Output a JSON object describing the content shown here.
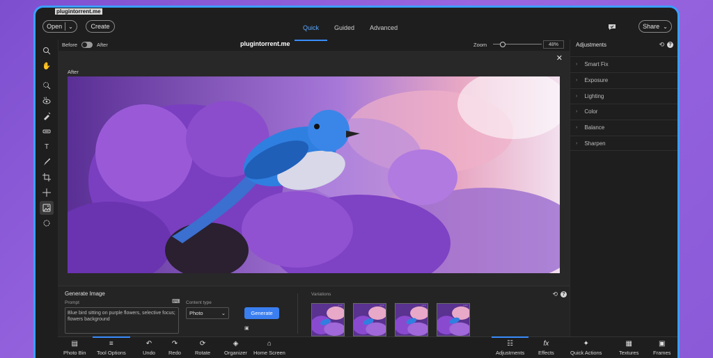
{
  "watermark_top": "plugintorrent.me",
  "watermark_mid": "plugintorrent.me",
  "topbar": {
    "open_label": "Open",
    "create_label": "Create",
    "share_label": "Share",
    "modes": [
      "Quick",
      "Guided",
      "Advanced"
    ],
    "active_mode": "Quick"
  },
  "canvas_head": {
    "before_label": "Before",
    "after_label": "After",
    "zoom_label": "Zoom",
    "zoom_value": "48%",
    "zoom_fraction": 0.15
  },
  "canvas": {
    "view_label": "After",
    "close_glyph": "✕"
  },
  "right_panel": {
    "title": "Adjustments",
    "items": [
      "Smart Fix",
      "Exposure",
      "Lighting",
      "Color",
      "Balance",
      "Sharpen"
    ]
  },
  "generate": {
    "title": "Generate Image",
    "prompt_label": "Prompt",
    "prompt_text": "Blue bird sitting on purple flowers, selective focus; flowers background",
    "content_type_label": "Content type",
    "content_type_value": "Photo",
    "generate_label": "Generate",
    "variations_label": "Variations",
    "variation_count": 4
  },
  "bottombar": {
    "left": [
      {
        "label": "Photo Bin",
        "icon": "photo-bin-icon"
      },
      {
        "label": "Tool Options",
        "icon": "tool-options-icon",
        "active": true
      },
      {
        "label": "Undo",
        "icon": "undo-icon"
      },
      {
        "label": "Redo",
        "icon": "redo-icon"
      },
      {
        "label": "Rotate",
        "icon": "rotate-icon"
      },
      {
        "label": "Organizer",
        "icon": "organizer-icon"
      },
      {
        "label": "Home Screen",
        "icon": "home-icon"
      }
    ],
    "right": [
      {
        "label": "Adjustments",
        "icon": "adjustments-icon",
        "active": true
      },
      {
        "label": "Effects",
        "icon": "effects-icon"
      },
      {
        "label": "Quick Actions",
        "icon": "quick-actions-icon"
      },
      {
        "label": "Textures",
        "icon": "textures-icon"
      },
      {
        "label": "Frames",
        "icon": "frames-icon"
      }
    ]
  },
  "colors": {
    "accent": "#3a8dff",
    "generate_button": "#3a7ef0",
    "window_border": "#3aa0ff"
  }
}
